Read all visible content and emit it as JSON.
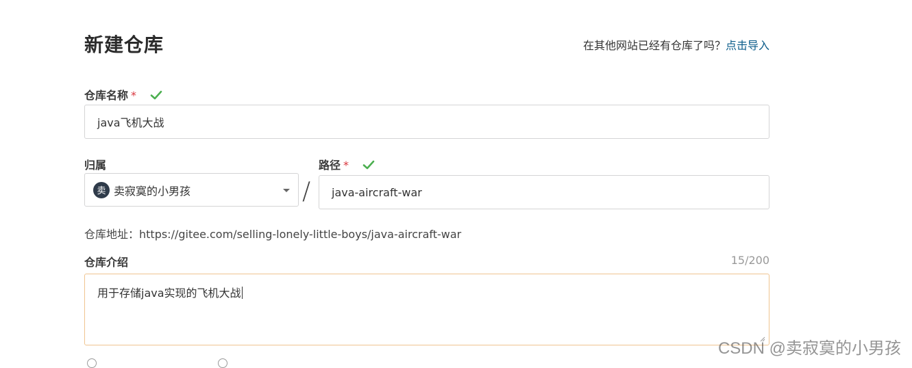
{
  "page": {
    "title": "新建仓库",
    "import_hint": "在其他网站已经有仓库了吗？",
    "import_link": "点击导入"
  },
  "repo_name": {
    "label": "仓库名称",
    "required": "*",
    "value": "java飞机大战"
  },
  "owner": {
    "label": "归属",
    "avatar_text": "卖",
    "value": "卖寂寞的小男孩"
  },
  "path": {
    "label": "路径",
    "required": "*",
    "separator": "/",
    "value": "java-aircraft-war"
  },
  "address": {
    "text": "仓库地址：https://gitee.com/selling-lonely-little-boys/java-aircraft-war"
  },
  "description": {
    "label": "仓库介绍",
    "counter": "15/200",
    "value": "用于存储java实现的飞机大战"
  },
  "watermark": "CSDN @卖寂寞的小男孩",
  "colors": {
    "check": "#4caf50",
    "required": "#d9363e",
    "link": "#0b5c8a",
    "focus_border": "#f0c48f"
  }
}
